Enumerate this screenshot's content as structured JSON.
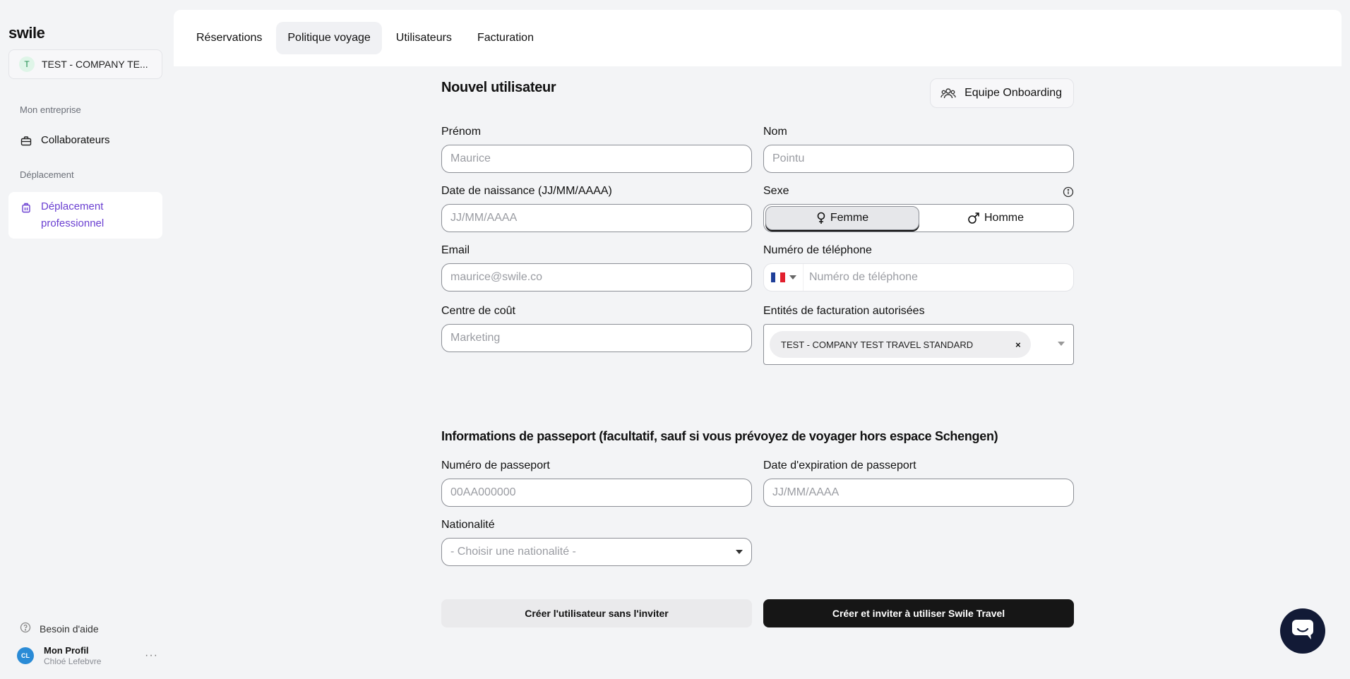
{
  "sidebar": {
    "logo": "swile",
    "company": {
      "badge": "T",
      "name": "TEST - COMPANY TE..."
    },
    "section_enterprise": "Mon entreprise",
    "item_collaborators": "Collaborateurs",
    "section_travel": "Déplacement",
    "item_business_travel_line1": "Déplacement",
    "item_business_travel_line2": "professionnel",
    "help": "Besoin d'aide",
    "profile": {
      "initials": "CL",
      "name": "Mon Profil",
      "user": "Chloé Lefebvre",
      "more": "···"
    }
  },
  "tabs": [
    "Réservations",
    "Politique voyage",
    "Utilisateurs",
    "Facturation"
  ],
  "form": {
    "title": "Nouvel utilisateur",
    "team_button": "Equipe Onboarding",
    "first_name": {
      "label": "Prénom",
      "placeholder": "Maurice"
    },
    "last_name": {
      "label": "Nom",
      "placeholder": "Pointu"
    },
    "birthdate": {
      "label": "Date de naissance (JJ/MM/AAAA)",
      "placeholder": "JJ/MM/AAAA"
    },
    "sex": {
      "label": "Sexe",
      "female": "Femme",
      "male": "Homme",
      "selected": "Femme"
    },
    "email": {
      "label": "Email",
      "placeholder": "maurice@swile.co"
    },
    "phone": {
      "label": "Numéro de téléphone",
      "placeholder": "Numéro de téléphone"
    },
    "cost_center": {
      "label": "Centre de coût",
      "placeholder": "Marketing"
    },
    "billing": {
      "label": "Entités de facturation autorisées",
      "chip": "TEST - COMPANY TEST TRAVEL STANDARD",
      "chip_remove": "×"
    },
    "passport_section": "Informations de passeport (facultatif, sauf si vous prévoyez de voyager hors espace Schengen)",
    "passport_number": {
      "label": "Numéro de passeport",
      "placeholder": "00AA000000"
    },
    "passport_expiry": {
      "label": "Date d'expiration de passeport",
      "placeholder": "JJ/MM/AAAA"
    },
    "nationality": {
      "label": "Nationalité",
      "placeholder": "- Choisir une nationalité -"
    },
    "btn_create": "Créer l'utilisateur sans l'inviter",
    "btn_create_invite": "Créer et inviter à utiliser Swile Travel"
  },
  "colors": {
    "accent": "#6a3fd1",
    "primary_button": "#161616",
    "chat_button": "#121a36"
  }
}
